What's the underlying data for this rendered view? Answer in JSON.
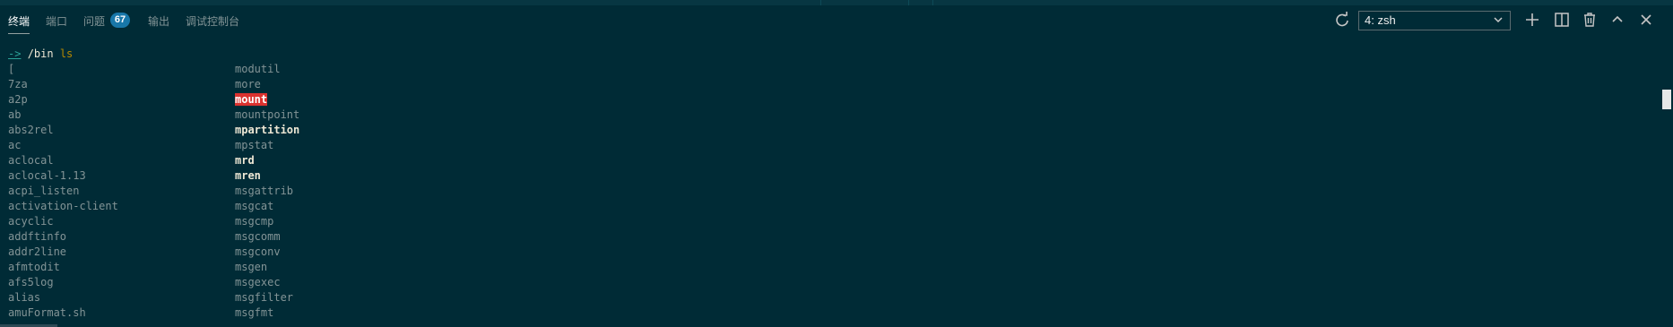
{
  "tabs": [
    {
      "label": "终端",
      "active": true
    },
    {
      "label": "端口",
      "active": false
    },
    {
      "label": "问题",
      "active": false,
      "badge": "67"
    },
    {
      "label": "输出",
      "active": false
    },
    {
      "label": "调试控制台",
      "active": false
    }
  ],
  "terminal_select": {
    "value": "4: zsh"
  },
  "toolbar_icons": [
    "refresh-icon",
    "plus-icon",
    "split-icon",
    "trash-icon",
    "chevron-up-icon",
    "close-icon"
  ],
  "prompt": {
    "arrow": "->",
    "dir": "/bin",
    "cmd": "ls"
  },
  "listing": {
    "col1": [
      "[",
      "7za",
      "a2p",
      "ab",
      "abs2rel",
      "ac",
      "aclocal",
      "aclocal-1.13",
      "acpi_listen",
      "activation-client",
      "acyclic",
      "addftinfo",
      "addr2line",
      "afmtodit",
      "afs5log",
      "alias",
      "amuFormat.sh"
    ],
    "col2": [
      "modutil",
      "more",
      "mount",
      "mountpoint",
      "mpartition",
      "mpstat",
      "mrd",
      "mren",
      "msgattrib",
      "msgcat",
      "msgcmp",
      "msgcomm",
      "msgconv",
      "msgen",
      "msgexec",
      "msgfilter",
      "msgfmt"
    ],
    "col2_bold": [
      "mpartition",
      "mrd",
      "mren"
    ],
    "col2_highlight": [
      "mount"
    ]
  },
  "colors": {
    "background": "#002b36",
    "highlight": "#dc322f",
    "badge": "#1877a9",
    "prompt_arrow": "#2aa198",
    "command": "#b58900"
  }
}
